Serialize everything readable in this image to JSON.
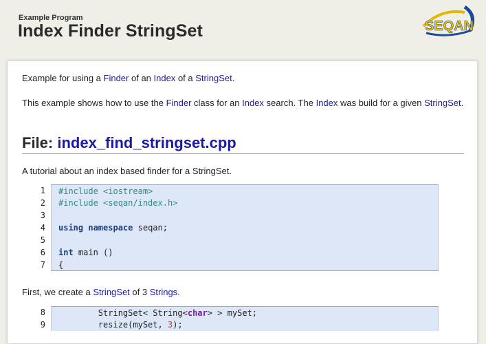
{
  "header": {
    "kicker": "Example Program",
    "title": "Index Finder StringSet",
    "logo_text": "SEQAN"
  },
  "intro": {
    "p1": {
      "t1": "Example for using a ",
      "l1": "Finder",
      "t2": " of an ",
      "l2": "Index",
      "t3": " of a ",
      "l3": "StringSet",
      "t4": "."
    },
    "p2": {
      "t1": "This example shows how to use the ",
      "l1": "Finder",
      "t2": " class for an ",
      "l2": "Index",
      "t3": " search. The ",
      "l3": "Index",
      "t4": " was build for a given ",
      "l4": "StringSet",
      "t5": "."
    }
  },
  "file": {
    "label": "File: ",
    "name": "index_find_stringset.cpp",
    "description": "A tutorial about an index based finder for a StringSet."
  },
  "code1": {
    "lines": [
      {
        "n": "1",
        "parts": [
          {
            "c": "pp",
            "t": "#include <iostream>"
          }
        ]
      },
      {
        "n": "2",
        "parts": [
          {
            "c": "pp",
            "t": "#include <seqan/index.h>"
          }
        ]
      },
      {
        "n": "3",
        "parts": []
      },
      {
        "n": "4",
        "parts": [
          {
            "c": "kw",
            "t": "using"
          },
          {
            "c": "",
            "t": " "
          },
          {
            "c": "kw",
            "t": "namespace"
          },
          {
            "c": "",
            "t": " seqan;"
          }
        ]
      },
      {
        "n": "5",
        "parts": []
      },
      {
        "n": "6",
        "parts": [
          {
            "c": "kw",
            "t": "int"
          },
          {
            "c": "",
            "t": " main ()"
          }
        ]
      },
      {
        "n": "7",
        "parts": [
          {
            "c": "",
            "t": "{"
          }
        ]
      }
    ]
  },
  "step1": {
    "t1": "First, we create a ",
    "l1": "StringSet",
    "t2": " of 3 ",
    "l2": "Strings",
    "t3": "."
  },
  "code2": {
    "lines": [
      {
        "n": "8",
        "parts": [
          {
            "c": "",
            "t": "        StringSet< String<"
          },
          {
            "c": "ty",
            "t": "char"
          },
          {
            "c": "",
            "t": "> > mySet;"
          }
        ]
      },
      {
        "n": "9",
        "parts": [
          {
            "c": "",
            "t": "        resize(mySet, "
          },
          {
            "c": "num",
            "t": "3"
          },
          {
            "c": "",
            "t": ");"
          }
        ]
      }
    ]
  },
  "colors": {
    "link": "#1a1aa6",
    "code_bg": "#dde7f8",
    "page_bg": "#efefe8",
    "logo_yellow": "#f2c500",
    "logo_blue": "#1a4a9a"
  }
}
